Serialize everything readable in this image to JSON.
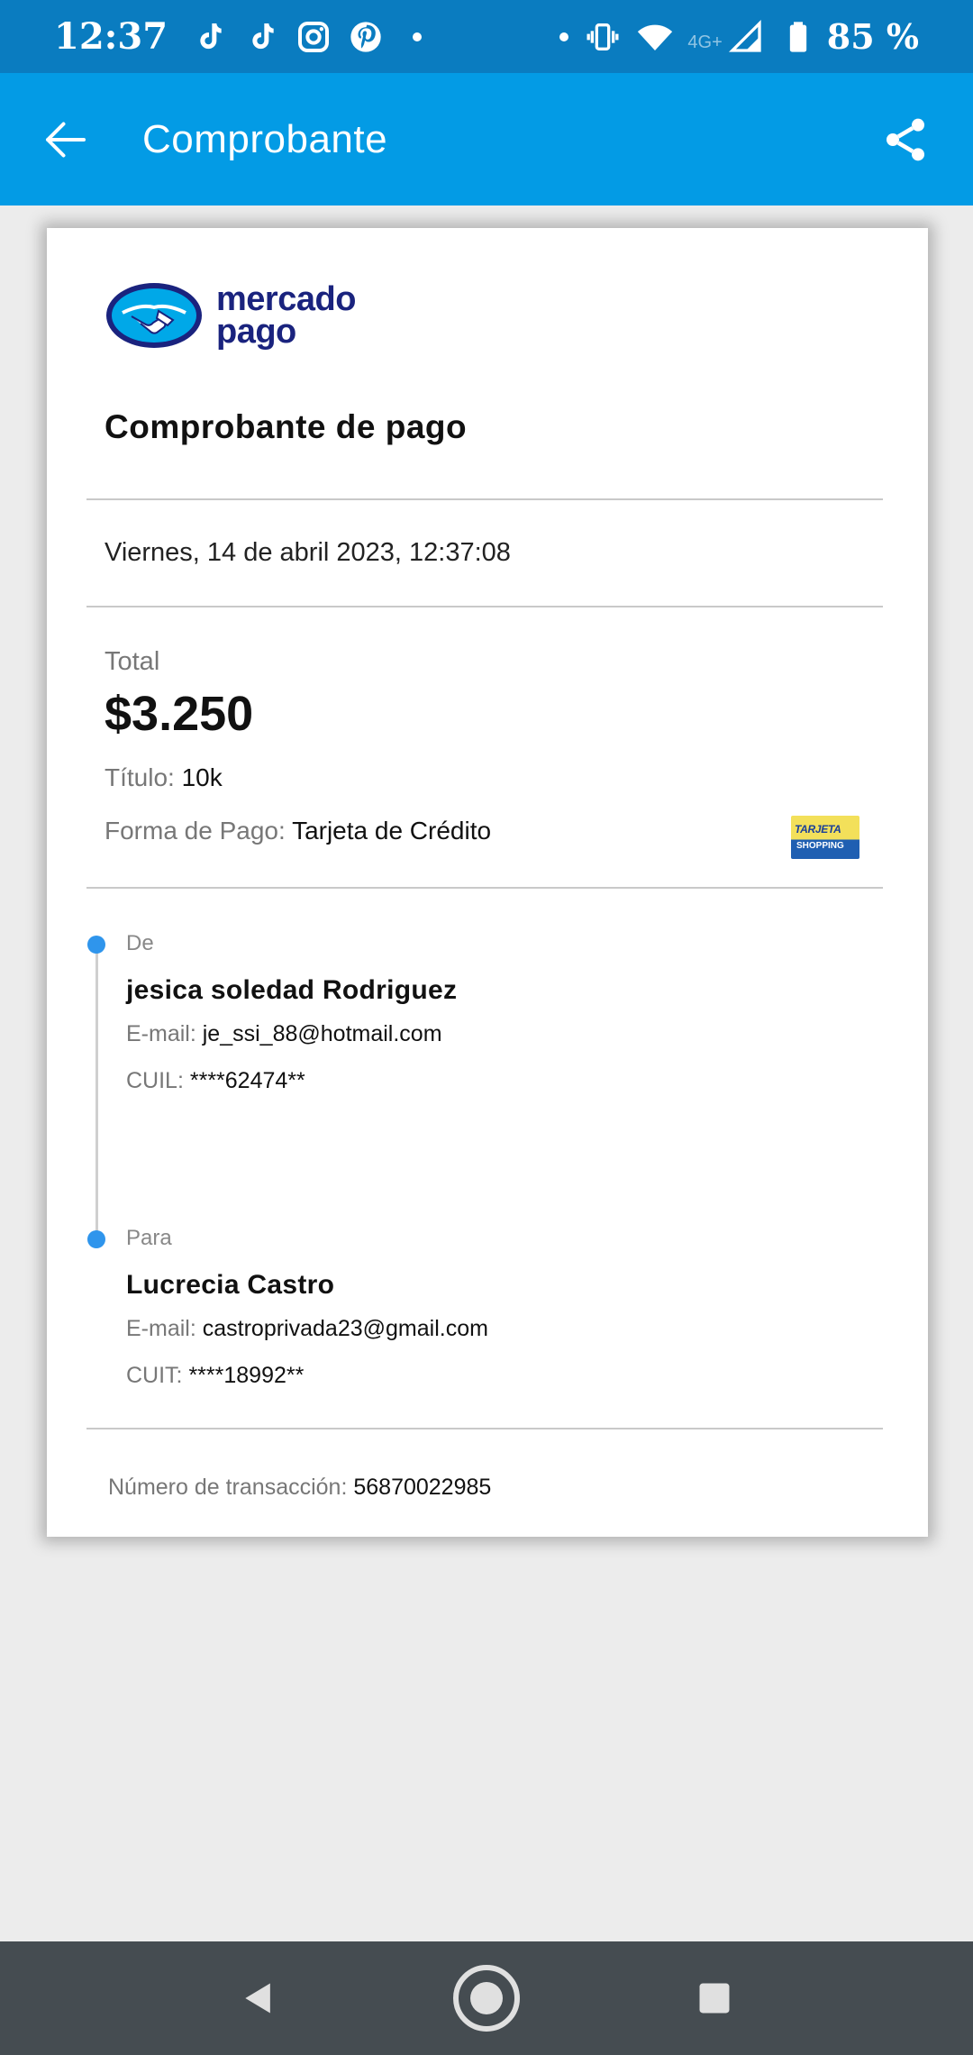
{
  "status_bar": {
    "time": "12:37",
    "network": "4G+",
    "battery": "85 %",
    "icons": [
      "tiktok-icon",
      "tiktok-icon",
      "instagram-icon",
      "pinterest-icon",
      "dot-icon",
      "vibrate-icon",
      "wifi-icon",
      "signal-icon",
      "battery-icon"
    ]
  },
  "app_bar": {
    "title": "Comprobante",
    "back_icon": "arrow-left-icon",
    "share_icon": "share-icon",
    "color": "#039be5"
  },
  "receipt": {
    "logo_text_line1": "mercado",
    "logo_text_line2": "pago",
    "title": "Comprobante de pago",
    "date": "Viernes, 14 de abril 2023, 12:37:08",
    "total_label": "Total",
    "total_amount": "$3.250",
    "titulo_label": "Título:",
    "titulo_value": "10k",
    "payment_label": "Forma de Pago:",
    "payment_value": "Tarjeta de Crédito",
    "card_brand_line1": "TARJETA",
    "card_brand_line2": "SHOPPING",
    "from": {
      "label": "De",
      "name": "jesica soledad Rodriguez",
      "email_label": "E-mail:",
      "email": "je_ssi_88@hotmail.com",
      "id_label": "CUIL:",
      "id": "****62474**"
    },
    "to": {
      "label": "Para",
      "name": "Lucrecia Castro",
      "email_label": "E-mail:",
      "email": "castroprivada23@gmail.com",
      "id_label": "CUIT:",
      "id": "****18992**"
    },
    "transaction_label": "Número de transacción:",
    "transaction_number": "56870022985"
  },
  "nav_bar": {
    "icons": [
      "back-triangle-icon",
      "home-circle-icon",
      "recents-square-icon"
    ]
  }
}
